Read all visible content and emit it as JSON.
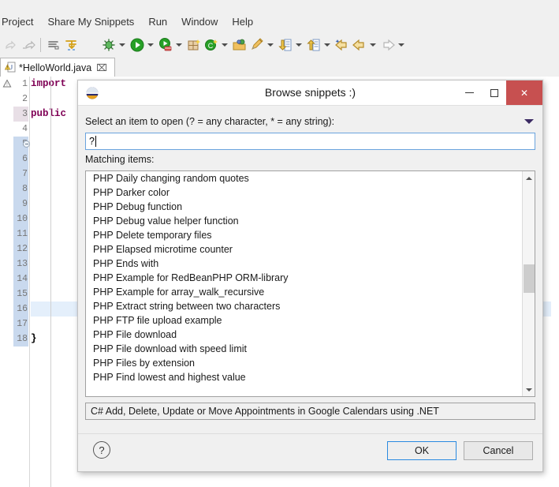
{
  "ide": {
    "menu": [
      {
        "label": "Project"
      },
      {
        "label": "Share My Snippets"
      },
      {
        "label": "Run"
      },
      {
        "label": "Window"
      },
      {
        "label": "Help"
      }
    ],
    "tab": {
      "label": "*HelloWorld.java",
      "close": "⌧",
      "icon": "java-file-warning-icon"
    },
    "toolbar": {
      "items": [
        "back-icon",
        "forward-icon",
        "separator",
        "toggle-markoccurrences-icon",
        "skip-breakpoints-icon",
        "debug-icon",
        "debug-dropdown",
        "run-icon",
        "run-dropdown",
        "run-coverage-icon",
        "coverage-dropdown",
        "new-java-package-icon",
        "new-java-class-icon",
        "new-class-dropdown",
        "open-task-icon",
        "edit-task-icon",
        "edit-task-dropdown",
        "previous-annotation-icon",
        "prev-annotation-dropdown",
        "next-annotation-icon",
        "next-annotation-dropdown",
        "back-nav-icon",
        "back-nav-dropdown",
        "forward-nav-icon",
        "forward-nav-dropdown"
      ]
    },
    "editor": {
      "lines": [
        {
          "n": "1",
          "text": "import",
          "kind": "keyword"
        },
        {
          "n": "2",
          "text": "",
          "kind": "plain"
        },
        {
          "n": "3",
          "text": "public",
          "kind": "keyword"
        },
        {
          "n": "4",
          "text": "",
          "kind": "plain"
        },
        {
          "n": "5",
          "text": "",
          "kind": "plain"
        },
        {
          "n": "6",
          "text": "",
          "kind": "plain"
        },
        {
          "n": "7",
          "text": "",
          "kind": "plain"
        },
        {
          "n": "8",
          "text": "",
          "kind": "plain"
        },
        {
          "n": "9",
          "text": "",
          "kind": "plain"
        },
        {
          "n": "10",
          "text": "",
          "kind": "plain"
        },
        {
          "n": "11",
          "text": "",
          "kind": "plain"
        },
        {
          "n": "12",
          "text": "",
          "kind": "plain"
        },
        {
          "n": "13",
          "text": "",
          "kind": "plain"
        },
        {
          "n": "14",
          "text": "",
          "kind": "plain"
        },
        {
          "n": "15",
          "text": "",
          "kind": "plain"
        },
        {
          "n": "16",
          "text": "",
          "kind": "plain"
        },
        {
          "n": "17",
          "text": "",
          "kind": "plain"
        },
        {
          "n": "18",
          "text": "}",
          "kind": "brace"
        }
      ],
      "current_line": "3",
      "highlighted_line": "16",
      "fold_line": "5"
    }
  },
  "dialog": {
    "title": "Browse snippets :)",
    "app_icon": "eclipse-icon",
    "window_buttons": {
      "minimize": "minimize-icon",
      "maximize": "maximize-icon",
      "close": "✕"
    },
    "prompt_label": "Select an item to open (? = any character, * = any string):",
    "filter": {
      "value": "?",
      "placeholder": ""
    },
    "matching_label": "Matching items:",
    "items": [
      "PHP Daily changing random quotes",
      "PHP Darker color",
      "PHP Debug function",
      "PHP Debug value helper function",
      "PHP Delete temporary files",
      "PHP Elapsed microtime counter",
      "PHP Ends with",
      "PHP Example for RedBeanPHP ORM-library",
      "PHP Example for array_walk_recursive",
      "PHP Extract string between two characters",
      "PHP FTP file upload example",
      "PHP File download",
      "PHP File download with speed limit",
      "PHP Files by extension",
      "PHP Find lowest and highest value"
    ],
    "status_text": "C# Add, Delete, Update or Move Appointments in Google Calendars using .NET",
    "help_label": "?",
    "ok_label": "OK",
    "cancel_label": "Cancel"
  },
  "colors": {
    "dialog_bg": "#f0f0f0",
    "close_red": "#c75050",
    "focus_blue": "#2a8ae0",
    "input_border": "#6aa3dd",
    "keyword_purple": "#7f0055",
    "gutter_select": "#c9d9ee",
    "line_highlight": "#e4effb"
  }
}
